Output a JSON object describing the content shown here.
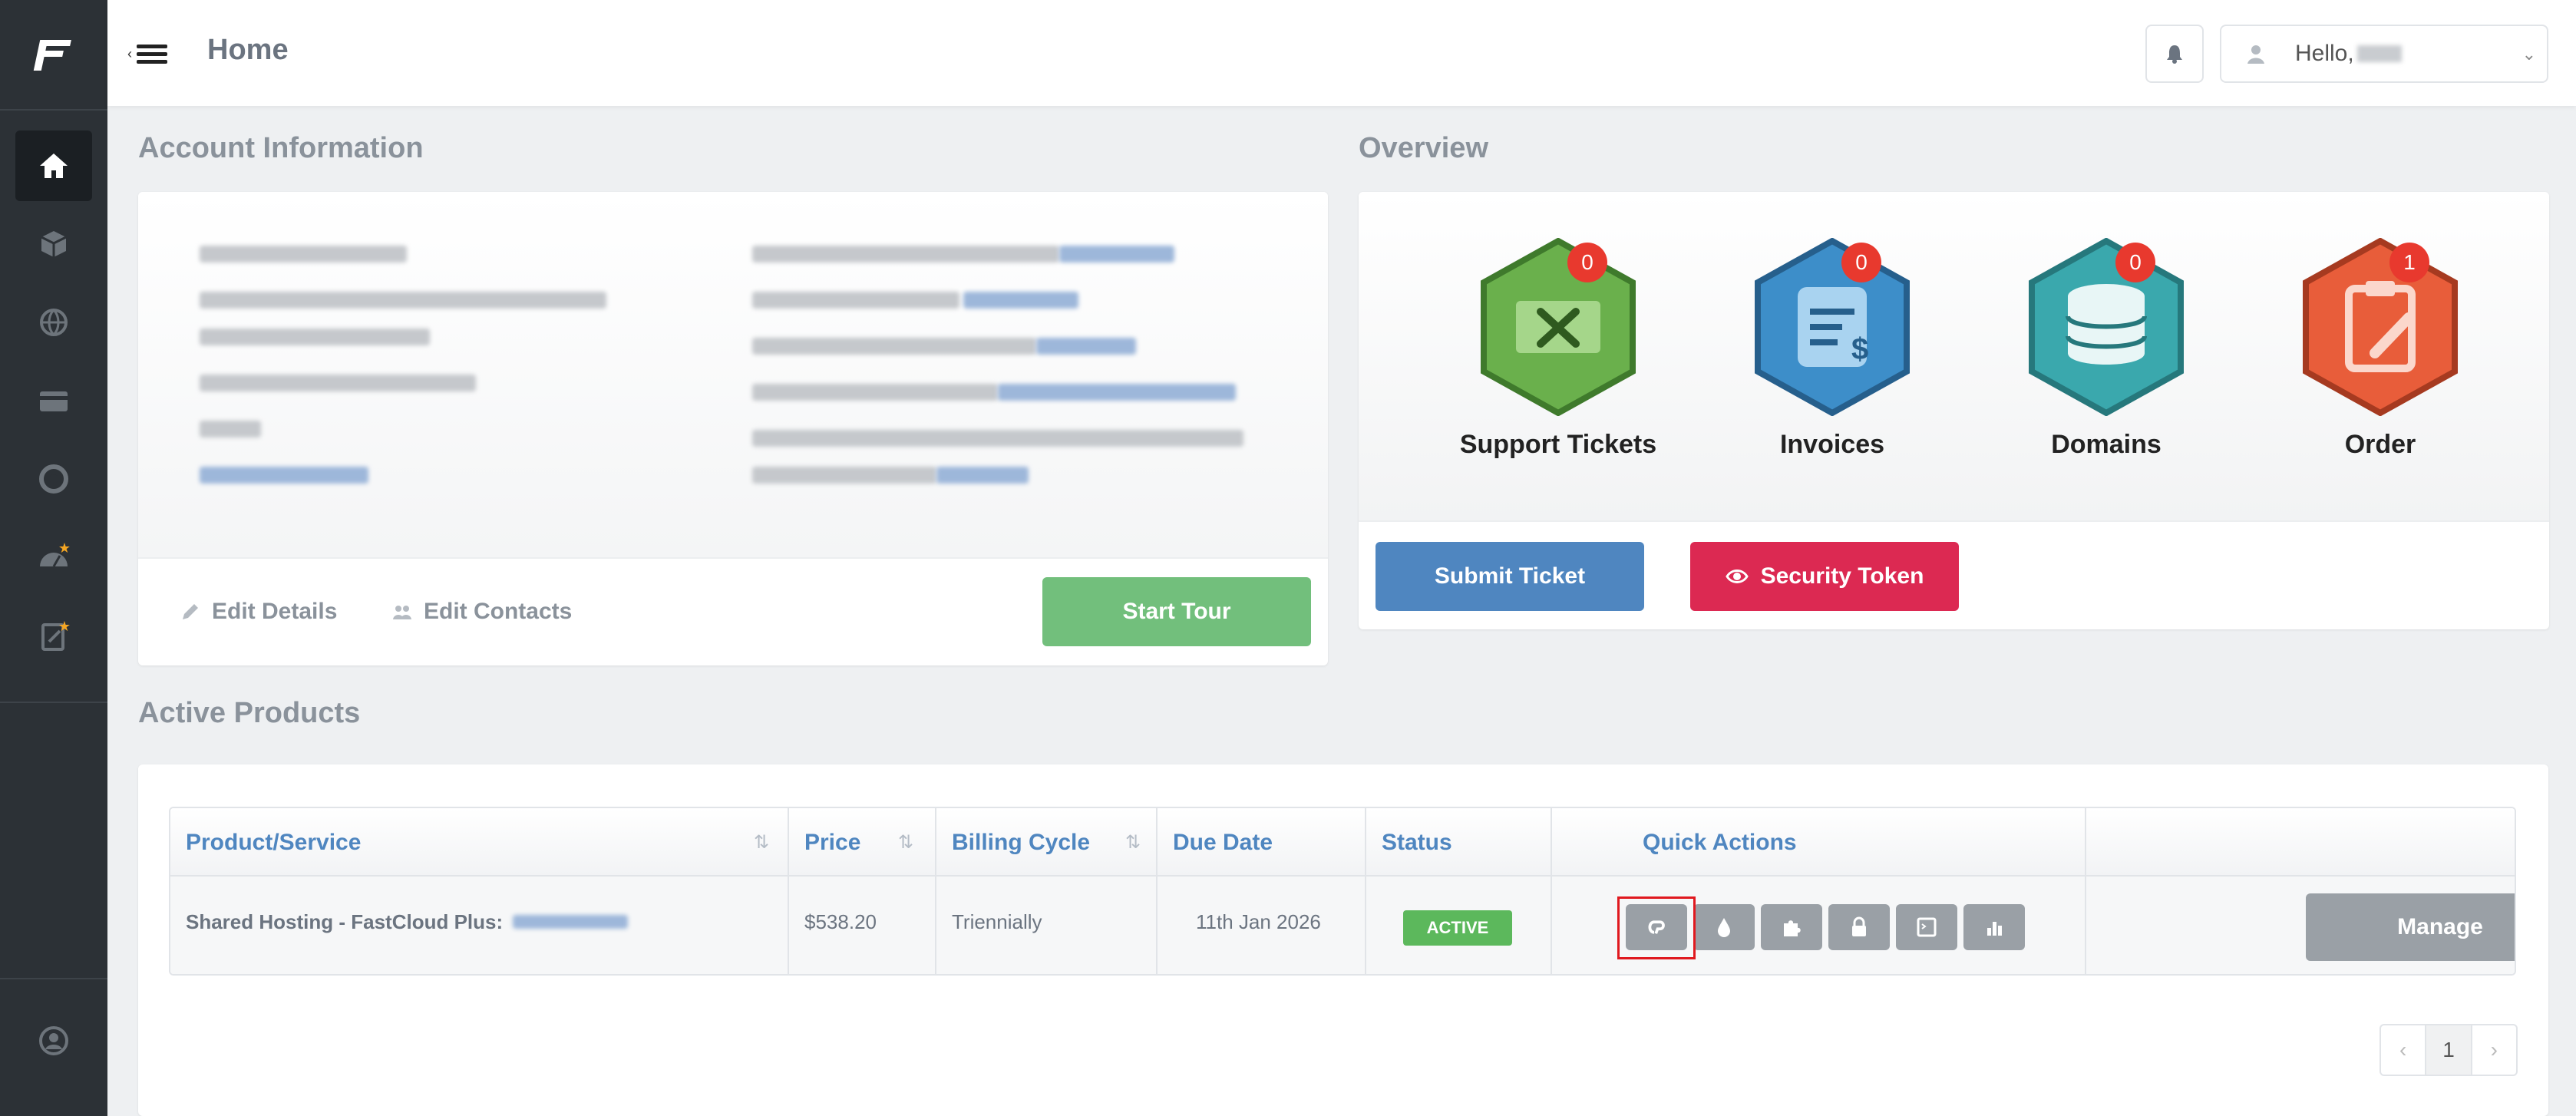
{
  "header": {
    "page_title": "Home",
    "greeting": "Hello,",
    "icons": [
      "menu-toggle-icon",
      "bell-icon",
      "user-icon",
      "chevron-down-icon"
    ]
  },
  "sidebar": {
    "items": [
      {
        "name": "home",
        "icon": "home-icon",
        "active": true
      },
      {
        "name": "services",
        "icon": "box-icon"
      },
      {
        "name": "domains",
        "icon": "globe-icon"
      },
      {
        "name": "billing",
        "icon": "credit-card-icon"
      },
      {
        "name": "support",
        "icon": "lifebuoy-icon"
      },
      {
        "name": "affiliates",
        "icon": "dashboard-star-icon"
      },
      {
        "name": "order",
        "icon": "clipboard-star-icon"
      },
      {
        "name": "account",
        "icon": "user-circle-icon"
      }
    ]
  },
  "account_info": {
    "title": "Account Information",
    "edit_details": "Edit Details",
    "edit_contacts": "Edit Contacts",
    "start_tour": "Start Tour"
  },
  "overview": {
    "title": "Overview",
    "cards": [
      {
        "label": "Support Tickets",
        "count": "0",
        "color": "#6ab04c"
      },
      {
        "label": "Invoices",
        "count": "0",
        "color": "#3d8ec9"
      },
      {
        "label": "Domains",
        "count": "0",
        "color": "#3aa8ad"
      },
      {
        "label": "Order",
        "count": "1",
        "color": "#e85d3a"
      }
    ],
    "submit_ticket": "Submit Ticket",
    "security_token": "Security Token"
  },
  "active_products": {
    "title": "Active Products",
    "columns": [
      "Product/Service",
      "Price",
      "Billing Cycle",
      "Due Date",
      "Status",
      "Quick Actions"
    ],
    "rows": [
      {
        "product": "Shared Hosting - FastCloud Plus:",
        "price": "$538.20",
        "billing_cycle": "Triennially",
        "due_date": "11th Jan 2026",
        "status": "ACTIVE",
        "manage": "Manage"
      }
    ],
    "quick_actions": [
      "cpanel-icon",
      "drop-icon",
      "puzzle-icon",
      "lock-icon",
      "ssh-terminal-icon",
      "bar-chart-icon"
    ],
    "pagination": {
      "prev": "‹",
      "current": "1",
      "next": "›"
    }
  }
}
